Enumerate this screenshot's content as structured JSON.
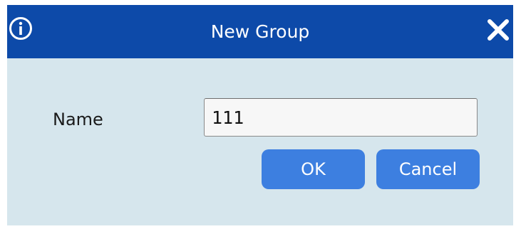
{
  "dialog": {
    "title": "New Group",
    "icons": {
      "info": "info-circle-icon",
      "close": "close-x-icon"
    },
    "colors": {
      "titlebar": "#0d4aa9",
      "body": "#d6e6ed",
      "button": "#3d7fe0",
      "title_text": "#ffffff"
    }
  },
  "form": {
    "name_label": "Name",
    "name_value": "111"
  },
  "buttons": {
    "ok_label": "OK",
    "cancel_label": "Cancel"
  }
}
